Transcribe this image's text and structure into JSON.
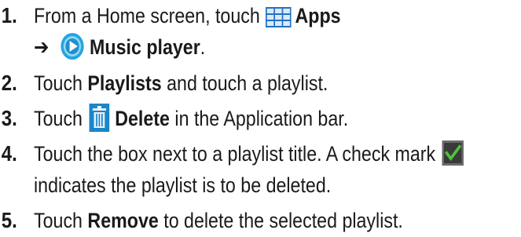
{
  "steps": [
    {
      "number": "1.",
      "line1_prefix": "From a Home screen, touch",
      "line1_bold": "Apps",
      "line2_arrow": "➔",
      "line2_bold": "Music player",
      "line2_suffix": "."
    },
    {
      "number": "2.",
      "prefix": "Touch",
      "bold": "Playlists",
      "suffix": "and touch a playlist."
    },
    {
      "number": "3.",
      "prefix": "Touch",
      "bold": "Delete",
      "suffix": "in the Application bar."
    },
    {
      "number": "4.",
      "line1": "Touch the box next to a playlist title. A check mark",
      "line2": "indicates the playlist is to be deleted."
    },
    {
      "number": "5.",
      "prefix": "Touch",
      "bold": "Remove",
      "suffix": "to delete the selected playlist."
    }
  ],
  "icons": {
    "apps": "apps-grid-icon",
    "music": "music-player-icon",
    "delete": "trash-icon",
    "check": "checkbox-checked-icon"
  },
  "colors": {
    "text": "#1a1a1a",
    "apps_blue": "#1f72c8",
    "music_blue": "#27a3e0",
    "trash_blue": "#1a86c8",
    "check_green": "#4ec23a"
  }
}
